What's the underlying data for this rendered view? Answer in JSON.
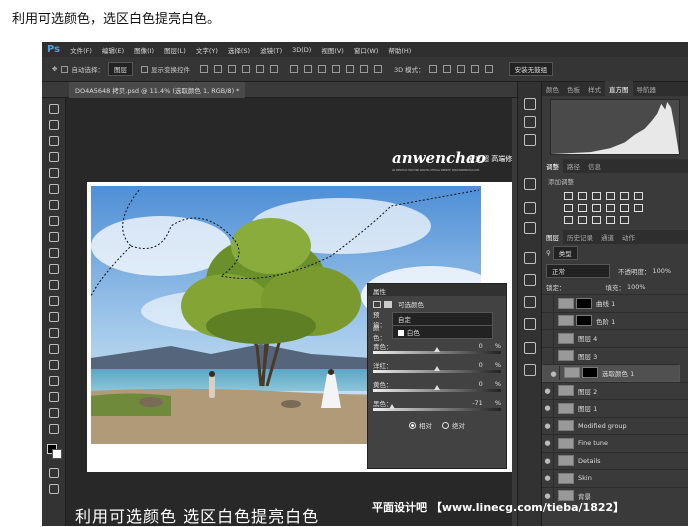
{
  "caption": "利用可选颜色，选区白色提亮白色。",
  "app": {
    "logo": "Ps"
  },
  "menu": [
    "文件(F)",
    "编辑(E)",
    "图像(I)",
    "图层(L)",
    "文字(Y)",
    "选择(S)",
    "滤镜(T)",
    "3D(D)",
    "视图(V)",
    "窗口(W)",
    "帮助(H)"
  ],
  "options": {
    "auto_select": "自动选择：",
    "target": "图层",
    "show_transform": "显示变换控件",
    "mode3d": "3D 模式：",
    "workspace": "安装无鼓组"
  },
  "document_tab": "DO4A5648 拷贝.psd @ 11.4% (选取颜色 1, RGB/8) *",
  "watermark_logo": "anwenchao",
  "watermark_brand": "安文超 高端修图",
  "watermark_small": "AN WENCHAO HIGH END GRAPHIC OFFICIAL WEBSITE: WWW.ANWENCHAO.COM",
  "panel_tabs_top": [
    "颜色",
    "色板",
    "样式",
    "直方图",
    "导航器"
  ],
  "panel_tabs_adj": [
    "调整",
    "路径",
    "信息"
  ],
  "adj_add": "添加调整",
  "panel_tabs_layers": [
    "图层",
    "历史记录",
    "通道",
    "动作"
  ],
  "layers_filter": "类型",
  "blend_mode": "正常",
  "opacity_label": "不透明度：",
  "opacity": "100%",
  "lock_label": "锁定：",
  "fill_label": "填充：",
  "fill": "100%",
  "layers": [
    {
      "name": "曲线 1",
      "visible": false,
      "selected": false
    },
    {
      "name": "色阶 1",
      "visible": false,
      "selected": false
    },
    {
      "name": "图层 4",
      "visible": false,
      "selected": false
    },
    {
      "name": "图层 3",
      "visible": false,
      "selected": false
    },
    {
      "name": "选取颜色 1",
      "visible": true,
      "selected": true
    },
    {
      "name": "图层 2",
      "visible": true,
      "selected": false
    },
    {
      "name": "图层 1",
      "visible": true,
      "selected": false
    },
    {
      "name": "Modified group",
      "visible": true,
      "selected": false
    },
    {
      "name": "Fine tune",
      "visible": true,
      "selected": false
    },
    {
      "name": "Details",
      "visible": true,
      "selected": false
    },
    {
      "name": "Skin",
      "visible": true,
      "selected": false
    },
    {
      "name": "背景",
      "visible": true,
      "selected": false
    }
  ],
  "properties": {
    "title": "属性",
    "subtitle": "可选颜色",
    "preset_label": "预设：",
    "preset": "自定",
    "color_label": "颜色：",
    "color": "白色",
    "channels": [
      {
        "name": "青色：",
        "value": "0",
        "unit": "%",
        "pct": 0.5
      },
      {
        "name": "洋红：",
        "value": "0",
        "unit": "%",
        "pct": 0.5
      },
      {
        "name": "黄色：",
        "value": "0",
        "unit": "%",
        "pct": 0.5
      },
      {
        "name": "黑色：",
        "value": "-71",
        "unit": "%",
        "pct": 0.145
      }
    ],
    "method_relative": "相对",
    "method_absolute": "绝对",
    "method_selected": "relative"
  },
  "image_caption": "利用可选颜色 选区白色提亮白色",
  "site_watermark": "平面设计吧 【www.linecg.com/tieba/1822】"
}
